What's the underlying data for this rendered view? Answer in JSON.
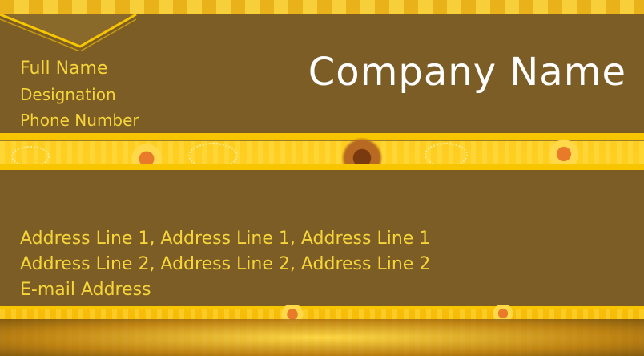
{
  "card": {
    "full_name": "Full Name",
    "designation": "Designation",
    "phone": "Phone Number",
    "company": "Company Name",
    "address_line_1": "Address Line 1,  Address Line 1,  Address Line 1",
    "address_line_2": "Address Line 2,  Address Line 2,  Address Line 2",
    "email": "E-mail Address"
  },
  "colors": {
    "band": "#7d5d26",
    "gold": "#f8c600",
    "text_gold": "#f5d53a",
    "text_white": "#ffffff"
  }
}
